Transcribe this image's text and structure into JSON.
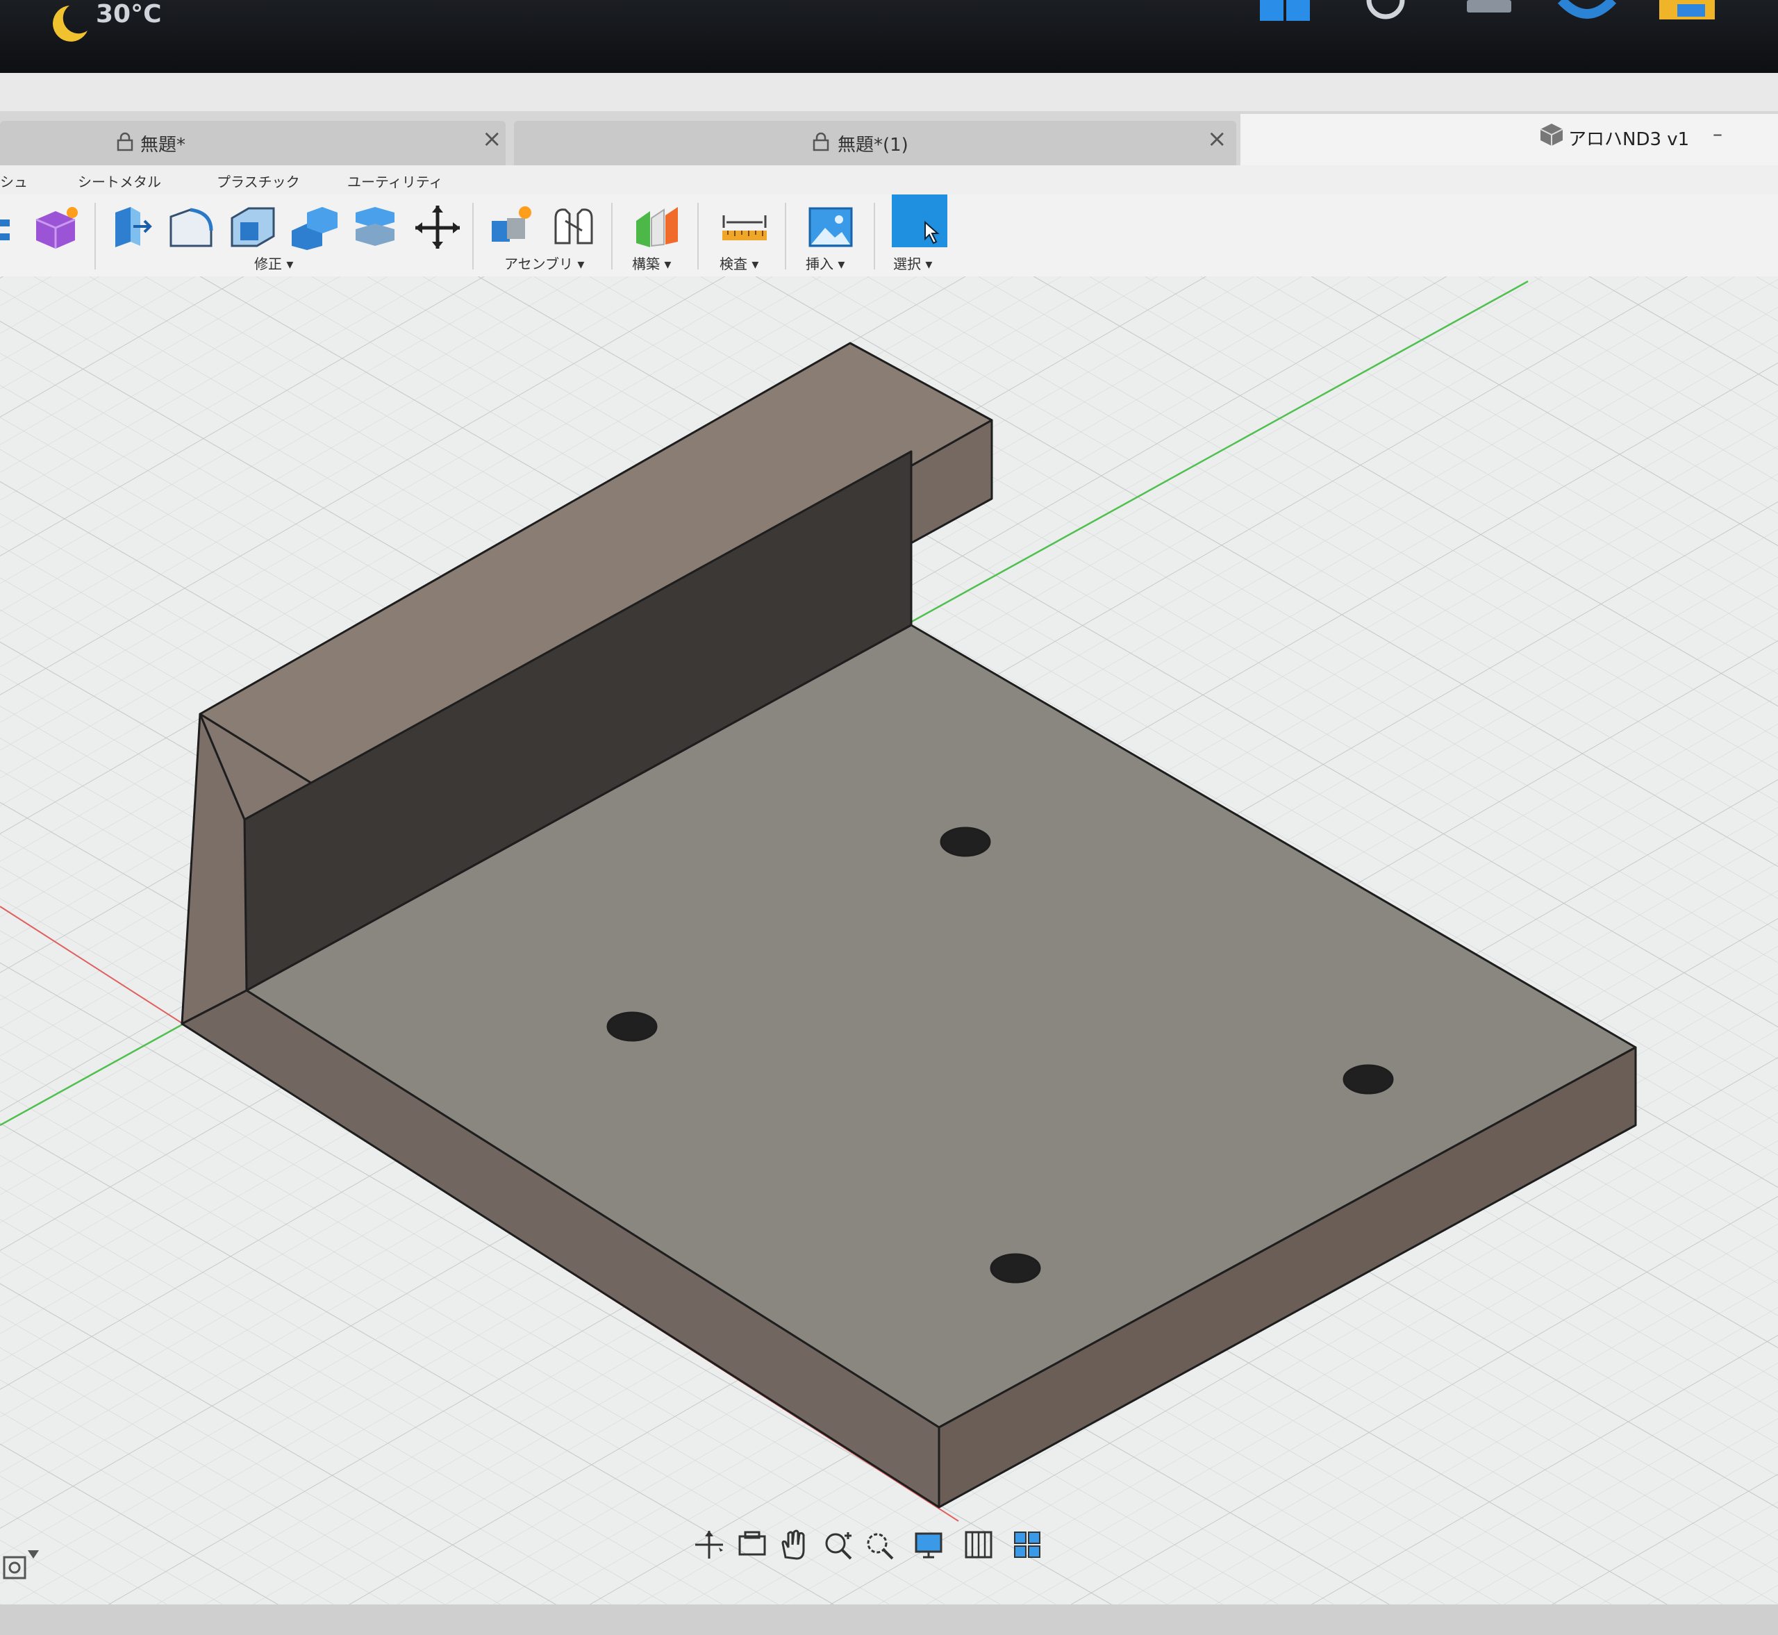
{
  "taskbar": {
    "weather_temp": "30°C"
  },
  "tabs": [
    {
      "label": "無題*",
      "close": "×"
    },
    {
      "label": "無題*(1)",
      "close": "×"
    }
  ],
  "document": {
    "title": "アロハND3 v1",
    "menu": "–"
  },
  "ribbon_tabs": [
    "シュ",
    "シートメタル",
    "プラスチック",
    "ユーティリティ"
  ],
  "toolbar_groups": {
    "modify": "修正 ▾",
    "assemble": "アセンブリ ▾",
    "construct": "構築 ▾",
    "inspect": "検査 ▾",
    "insert": "挿入 ▾",
    "select": "選択 ▾"
  },
  "colors": {
    "select_accent": "#1f8fe0",
    "body_top": "#8a8781",
    "body_side": "#6a5e56",
    "grid_bg": "#eceeee"
  },
  "nav_icons": [
    "orbit-icon",
    "look-at-icon",
    "pan-icon",
    "zoom-icon",
    "fit-icon",
    "display-settings-icon",
    "grid-settings-icon",
    "viewports-icon"
  ]
}
